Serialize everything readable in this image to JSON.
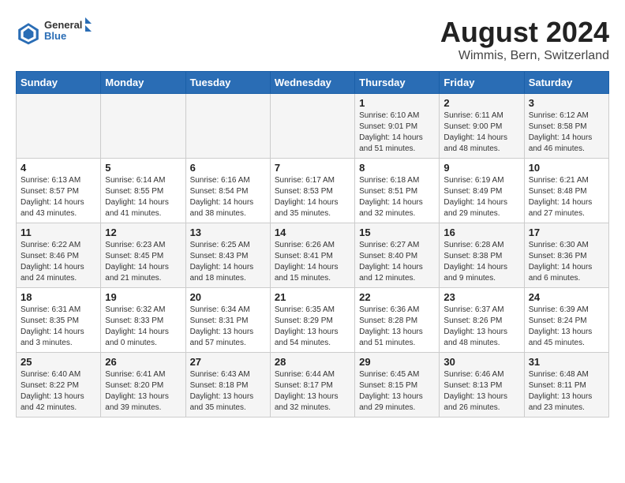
{
  "header": {
    "logo_general": "General",
    "logo_blue": "Blue",
    "title": "August 2024",
    "subtitle": "Wimmis, Bern, Switzerland"
  },
  "weekdays": [
    "Sunday",
    "Monday",
    "Tuesday",
    "Wednesday",
    "Thursday",
    "Friday",
    "Saturday"
  ],
  "weeks": [
    [
      {
        "day": "",
        "info": ""
      },
      {
        "day": "",
        "info": ""
      },
      {
        "day": "",
        "info": ""
      },
      {
        "day": "",
        "info": ""
      },
      {
        "day": "1",
        "info": "Sunrise: 6:10 AM\nSunset: 9:01 PM\nDaylight: 14 hours\nand 51 minutes."
      },
      {
        "day": "2",
        "info": "Sunrise: 6:11 AM\nSunset: 9:00 PM\nDaylight: 14 hours\nand 48 minutes."
      },
      {
        "day": "3",
        "info": "Sunrise: 6:12 AM\nSunset: 8:58 PM\nDaylight: 14 hours\nand 46 minutes."
      }
    ],
    [
      {
        "day": "4",
        "info": "Sunrise: 6:13 AM\nSunset: 8:57 PM\nDaylight: 14 hours\nand 43 minutes."
      },
      {
        "day": "5",
        "info": "Sunrise: 6:14 AM\nSunset: 8:55 PM\nDaylight: 14 hours\nand 41 minutes."
      },
      {
        "day": "6",
        "info": "Sunrise: 6:16 AM\nSunset: 8:54 PM\nDaylight: 14 hours\nand 38 minutes."
      },
      {
        "day": "7",
        "info": "Sunrise: 6:17 AM\nSunset: 8:53 PM\nDaylight: 14 hours\nand 35 minutes."
      },
      {
        "day": "8",
        "info": "Sunrise: 6:18 AM\nSunset: 8:51 PM\nDaylight: 14 hours\nand 32 minutes."
      },
      {
        "day": "9",
        "info": "Sunrise: 6:19 AM\nSunset: 8:49 PM\nDaylight: 14 hours\nand 29 minutes."
      },
      {
        "day": "10",
        "info": "Sunrise: 6:21 AM\nSunset: 8:48 PM\nDaylight: 14 hours\nand 27 minutes."
      }
    ],
    [
      {
        "day": "11",
        "info": "Sunrise: 6:22 AM\nSunset: 8:46 PM\nDaylight: 14 hours\nand 24 minutes."
      },
      {
        "day": "12",
        "info": "Sunrise: 6:23 AM\nSunset: 8:45 PM\nDaylight: 14 hours\nand 21 minutes."
      },
      {
        "day": "13",
        "info": "Sunrise: 6:25 AM\nSunset: 8:43 PM\nDaylight: 14 hours\nand 18 minutes."
      },
      {
        "day": "14",
        "info": "Sunrise: 6:26 AM\nSunset: 8:41 PM\nDaylight: 14 hours\nand 15 minutes."
      },
      {
        "day": "15",
        "info": "Sunrise: 6:27 AM\nSunset: 8:40 PM\nDaylight: 14 hours\nand 12 minutes."
      },
      {
        "day": "16",
        "info": "Sunrise: 6:28 AM\nSunset: 8:38 PM\nDaylight: 14 hours\nand 9 minutes."
      },
      {
        "day": "17",
        "info": "Sunrise: 6:30 AM\nSunset: 8:36 PM\nDaylight: 14 hours\nand 6 minutes."
      }
    ],
    [
      {
        "day": "18",
        "info": "Sunrise: 6:31 AM\nSunset: 8:35 PM\nDaylight: 14 hours\nand 3 minutes."
      },
      {
        "day": "19",
        "info": "Sunrise: 6:32 AM\nSunset: 8:33 PM\nDaylight: 14 hours\nand 0 minutes."
      },
      {
        "day": "20",
        "info": "Sunrise: 6:34 AM\nSunset: 8:31 PM\nDaylight: 13 hours\nand 57 minutes."
      },
      {
        "day": "21",
        "info": "Sunrise: 6:35 AM\nSunset: 8:29 PM\nDaylight: 13 hours\nand 54 minutes."
      },
      {
        "day": "22",
        "info": "Sunrise: 6:36 AM\nSunset: 8:28 PM\nDaylight: 13 hours\nand 51 minutes."
      },
      {
        "day": "23",
        "info": "Sunrise: 6:37 AM\nSunset: 8:26 PM\nDaylight: 13 hours\nand 48 minutes."
      },
      {
        "day": "24",
        "info": "Sunrise: 6:39 AM\nSunset: 8:24 PM\nDaylight: 13 hours\nand 45 minutes."
      }
    ],
    [
      {
        "day": "25",
        "info": "Sunrise: 6:40 AM\nSunset: 8:22 PM\nDaylight: 13 hours\nand 42 minutes."
      },
      {
        "day": "26",
        "info": "Sunrise: 6:41 AM\nSunset: 8:20 PM\nDaylight: 13 hours\nand 39 minutes."
      },
      {
        "day": "27",
        "info": "Sunrise: 6:43 AM\nSunset: 8:18 PM\nDaylight: 13 hours\nand 35 minutes."
      },
      {
        "day": "28",
        "info": "Sunrise: 6:44 AM\nSunset: 8:17 PM\nDaylight: 13 hours\nand 32 minutes."
      },
      {
        "day": "29",
        "info": "Sunrise: 6:45 AM\nSunset: 8:15 PM\nDaylight: 13 hours\nand 29 minutes."
      },
      {
        "day": "30",
        "info": "Sunrise: 6:46 AM\nSunset: 8:13 PM\nDaylight: 13 hours\nand 26 minutes."
      },
      {
        "day": "31",
        "info": "Sunrise: 6:48 AM\nSunset: 8:11 PM\nDaylight: 13 hours\nand 23 minutes."
      }
    ]
  ]
}
